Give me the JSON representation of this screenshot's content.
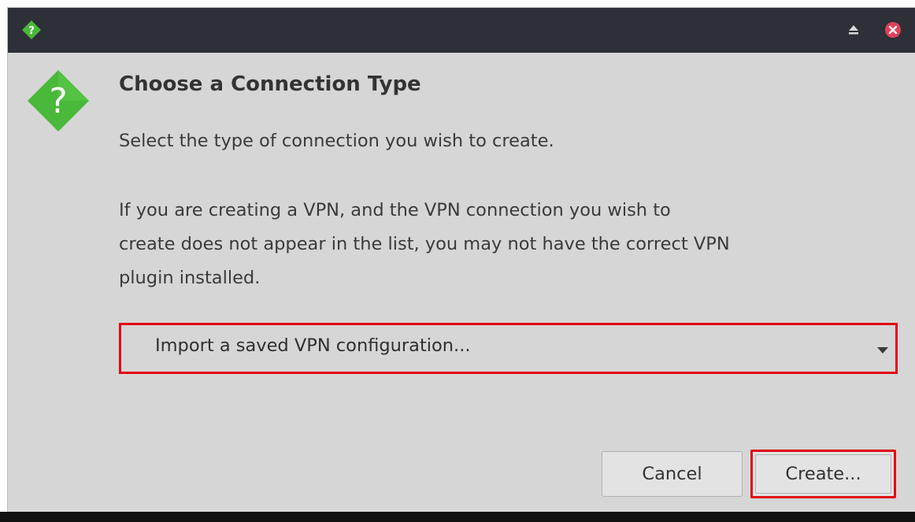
{
  "window": {
    "titlebar_color": "#2d3037",
    "background_color": "#d6d6d6",
    "highlight_color": "#e10712",
    "app_icon": "question-diamond-icon",
    "controls": [
      {
        "name": "maximize",
        "icon": "eject-triangle-icon"
      },
      {
        "name": "close",
        "icon": "close-circle-icon",
        "color": "#e0405a"
      }
    ]
  },
  "dialog": {
    "icon": "question-diamond-icon",
    "icon_color": "#4ab83a",
    "heading": "Choose a Connection Type",
    "subheading": "Select the type of connection you wish to create.",
    "body": "If you are creating a VPN, and the VPN connection you wish to\ncreate does not appear in the list, you may not have the correct VPN\nplugin installed.",
    "connection_type": {
      "selected": "Import a saved VPN configuration...",
      "icon": "chevron-down-icon"
    },
    "buttons": {
      "cancel": "Cancel",
      "create": "Create..."
    }
  }
}
